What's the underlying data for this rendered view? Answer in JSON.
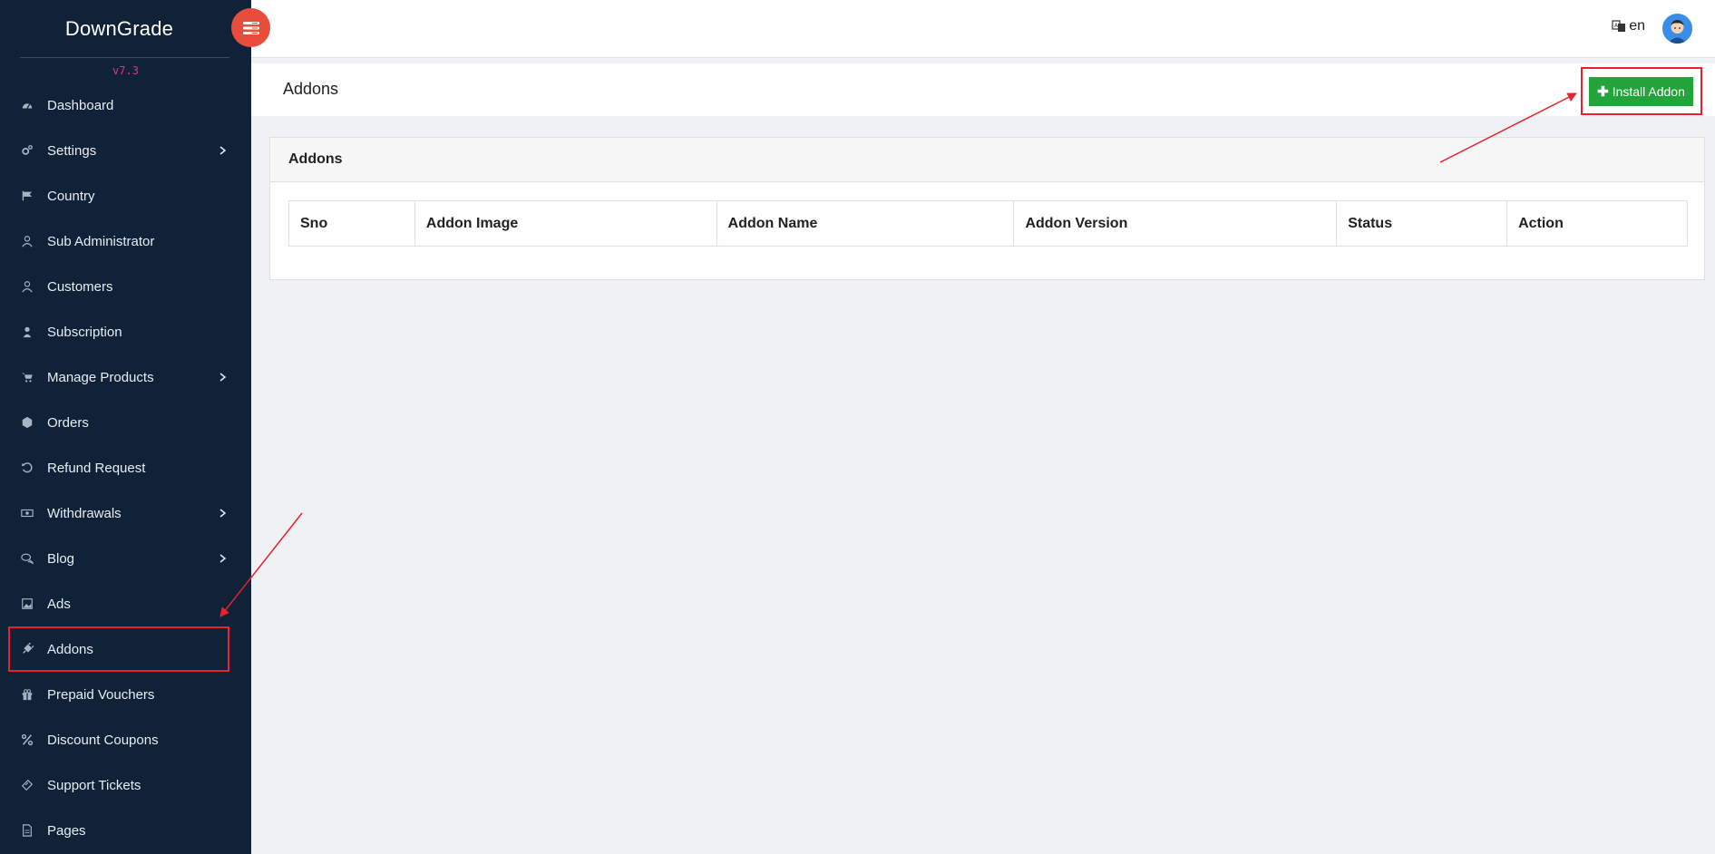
{
  "app": {
    "brand": "DownGrade",
    "version": "v7.3"
  },
  "sidebar": {
    "items": [
      {
        "label": "Dashboard",
        "icon": "dashboard-icon",
        "has_children": false
      },
      {
        "label": "Settings",
        "icon": "settings-icon",
        "has_children": true
      },
      {
        "label": "Country",
        "icon": "flag-icon",
        "has_children": false
      },
      {
        "label": "Sub Administrator",
        "icon": "user-outline-icon",
        "has_children": false
      },
      {
        "label": "Customers",
        "icon": "user-outline-icon",
        "has_children": false
      },
      {
        "label": "Subscription",
        "icon": "user-icon",
        "has_children": false
      },
      {
        "label": "Manage Products",
        "icon": "cart-icon",
        "has_children": true
      },
      {
        "label": "Orders",
        "icon": "box-icon",
        "has_children": false
      },
      {
        "label": "Refund Request",
        "icon": "undo-icon",
        "has_children": false
      },
      {
        "label": "Withdrawals",
        "icon": "money-icon",
        "has_children": true
      },
      {
        "label": "Blog",
        "icon": "comments-icon",
        "has_children": true
      },
      {
        "label": "Ads",
        "icon": "image-icon",
        "has_children": false
      },
      {
        "label": "Addons",
        "icon": "plug-icon",
        "has_children": false,
        "highlighted": true
      },
      {
        "label": "Prepaid Vouchers",
        "icon": "gift-icon",
        "has_children": false
      },
      {
        "label": "Discount Coupons",
        "icon": "percent-icon",
        "has_children": false
      },
      {
        "label": "Support Tickets",
        "icon": "ticket-icon",
        "has_children": false
      },
      {
        "label": "Pages",
        "icon": "file-icon",
        "has_children": false
      }
    ]
  },
  "topbar": {
    "language": "en",
    "language_icon": "translate-icon",
    "avatar_icon": "user-avatar-icon"
  },
  "page": {
    "title": "Addons",
    "install_button": "Install Addon",
    "card_title": "Addons",
    "table": {
      "columns": [
        "Sno",
        "Addon Image",
        "Addon Name",
        "Addon Version",
        "Status",
        "Action"
      ],
      "rows": []
    }
  },
  "colors": {
    "sidebar_bg": "#0f2238",
    "toggle_bg": "#e74c3c",
    "install_bg": "#23a43a",
    "annotation": "#e8212b",
    "version": "#e0348c"
  }
}
